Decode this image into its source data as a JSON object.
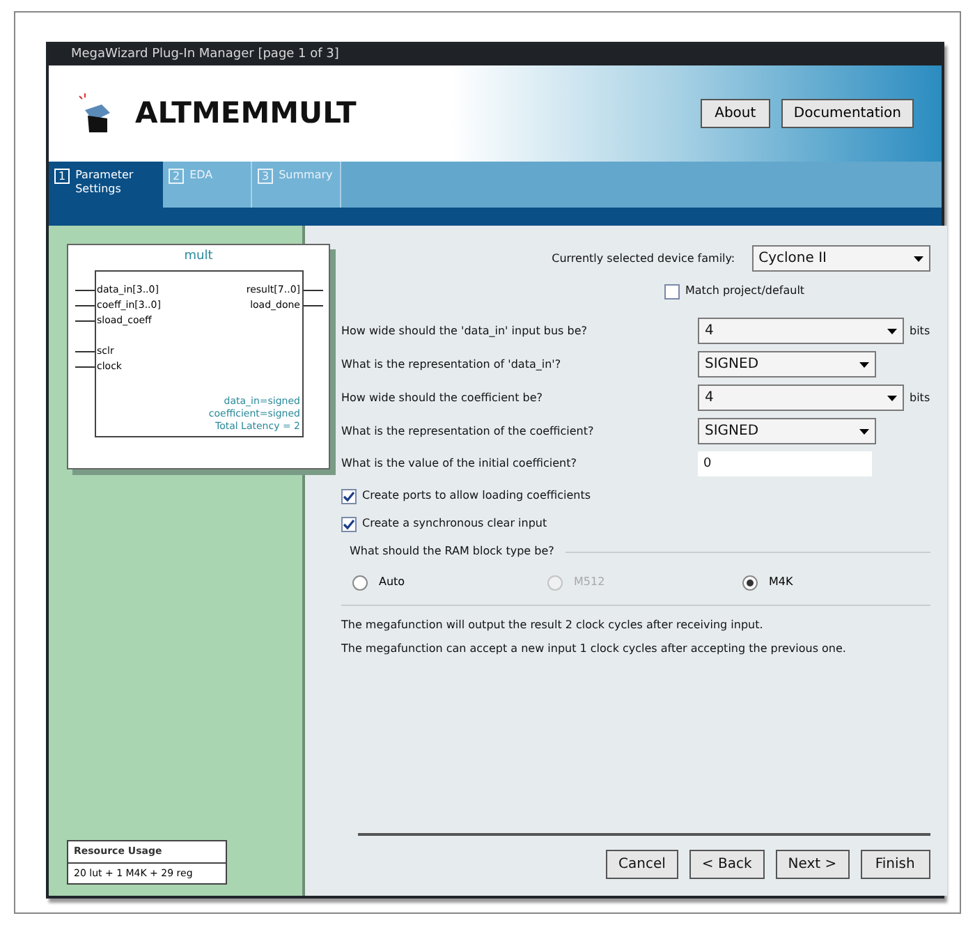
{
  "window": {
    "title": "MegaWizard Plug-In Manager [page 1 of 3]"
  },
  "header": {
    "title": "ALTMEMMULT",
    "buttons": [
      "About",
      "Documentation"
    ]
  },
  "tabs": [
    {
      "number": "1",
      "label": "Parameter Settings",
      "selected": true
    },
    {
      "number": "2",
      "label": "EDA",
      "selected": false
    },
    {
      "number": "3",
      "label": "Summary",
      "selected": false
    }
  ],
  "diagram": {
    "title": "mult",
    "input_groups": [
      [
        "data_in[3..0]",
        "coeff_in[3..0]",
        "sload_coeff"
      ],
      [
        "sclr",
        "clock"
      ]
    ],
    "outputs": [
      "result[7..0]",
      "load_done"
    ],
    "notes": [
      "data_in=signed",
      "coefficient=signed",
      "Total Latency = 2"
    ]
  },
  "resource_usage": {
    "title": "Resource Usage",
    "value": "20 lut + 1 M4K + 29 reg"
  },
  "device": {
    "label": "Currently selected device family:",
    "value": "Cyclone II",
    "match": {
      "label": "Match project/default",
      "checked": false
    }
  },
  "fields": [
    {
      "kind": "select",
      "label": "How wide should the 'data_in' input bus be?",
      "value": "4",
      "unit": "bits"
    },
    {
      "kind": "select",
      "label": "What is the representation of 'data_in'?",
      "value": "SIGNED"
    },
    {
      "kind": "select",
      "label": "How wide should the coefficient be?",
      "value": "4",
      "unit": "bits"
    },
    {
      "kind": "select",
      "label": "What is the representation of the coefficient?",
      "value": "SIGNED"
    },
    {
      "kind": "input",
      "label": "What is the value of the initial coefficient?",
      "value": "0"
    }
  ],
  "checkboxes": [
    {
      "label": "Create ports to allow loading coefficients",
      "checked": true
    },
    {
      "label": "Create a synchronous clear input",
      "checked": true
    }
  ],
  "ram_block": {
    "label": "What should the RAM block type be?",
    "options": [
      {
        "label": "Auto",
        "selected": false,
        "disabled": false
      },
      {
        "label": "M512",
        "selected": false,
        "disabled": true
      },
      {
        "label": "M4K",
        "selected": true,
        "disabled": false
      }
    ]
  },
  "messages": [
    "The megafunction will output the result 2 clock cycles after receiving input.",
    "The megafunction can accept a new input 1 clock cycles after accepting the previous one."
  ],
  "footer_buttons": [
    "Cancel",
    "< Back",
    "Next >",
    "Finish"
  ]
}
